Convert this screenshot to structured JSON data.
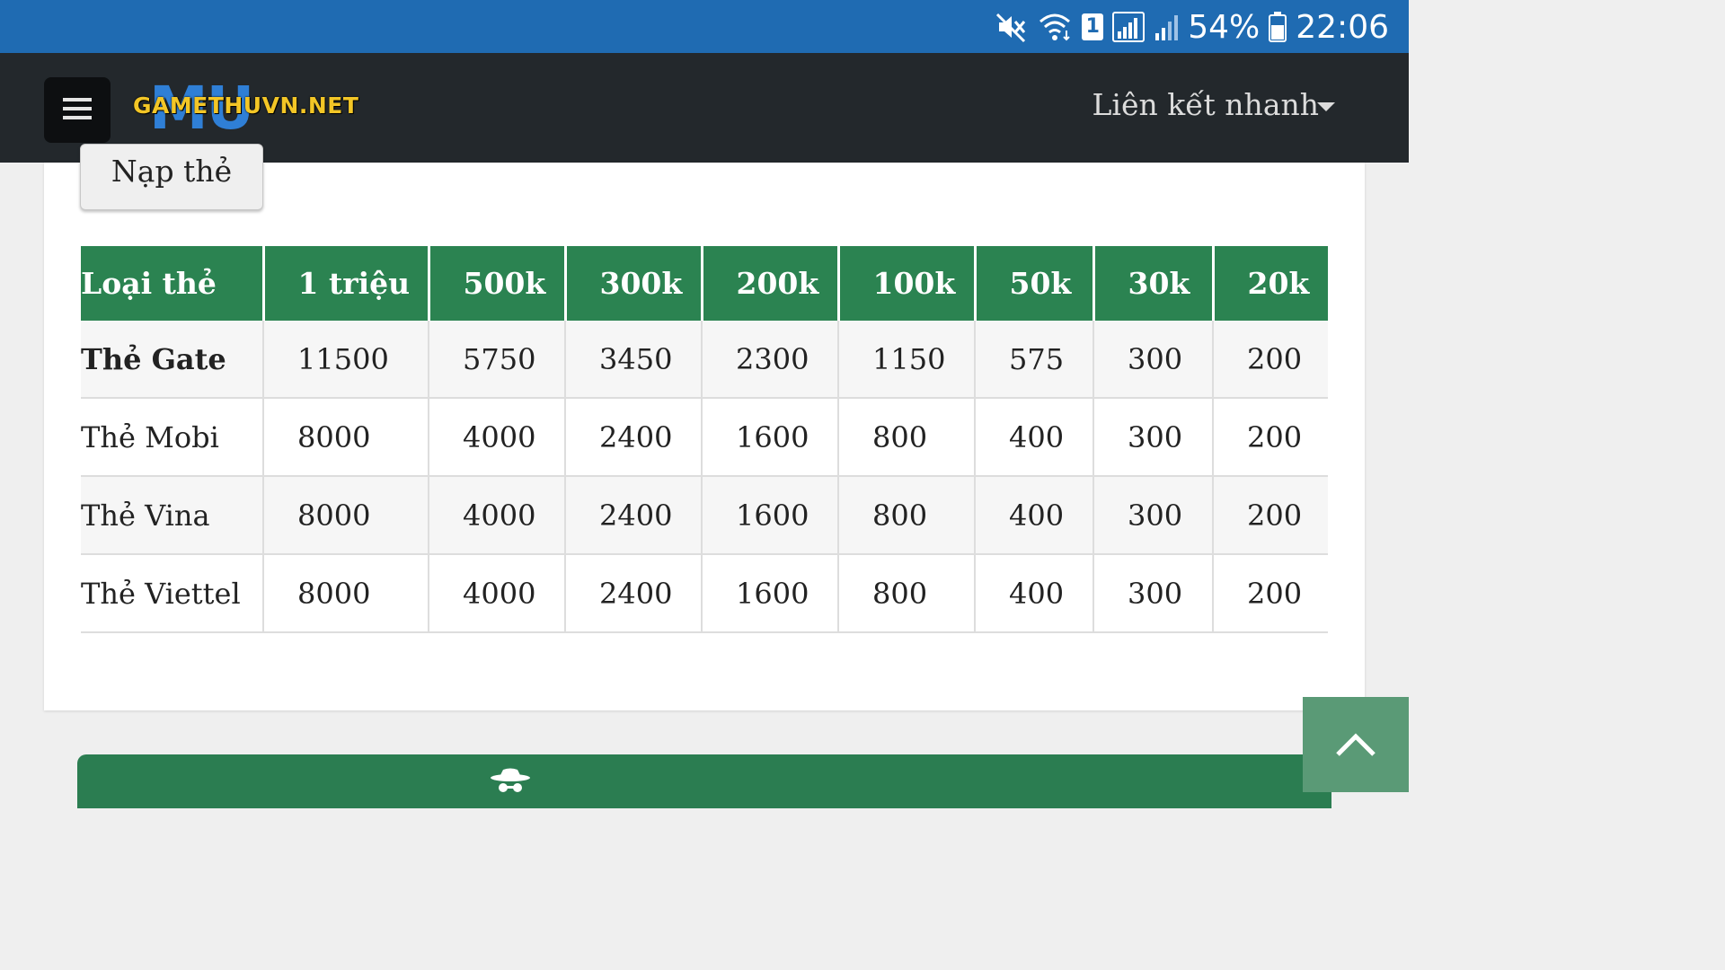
{
  "status_bar": {
    "battery_percent": "54%",
    "time": "22:06",
    "sim_badge": "1",
    "icons": [
      "mute-icon",
      "wifi-icon",
      "sim-icon",
      "signal-icon",
      "signal-2-icon",
      "battery-icon"
    ]
  },
  "navbar": {
    "menu_icon": "hamburger-icon",
    "logo_text": "GAMETHUVN.NET",
    "logo_mark": "MU",
    "quick_links_label": "Liên kết nhanh"
  },
  "content": {
    "recharge_button_label": "Nạp thẻ",
    "table": {
      "headers": [
        "Loại thẻ",
        "1 triệu",
        "500k",
        "300k",
        "200k",
        "100k",
        "50k",
        "30k",
        "20k"
      ],
      "rows": [
        [
          "Thẻ Gate",
          "11500",
          "5750",
          "3450",
          "2300",
          "1150",
          "575",
          "300",
          "200"
        ],
        [
          "Thẻ Mobi",
          "8000",
          "4000",
          "2400",
          "1600",
          "800",
          "400",
          "300",
          "200"
        ],
        [
          "Thẻ Vina",
          "8000",
          "4000",
          "2400",
          "1600",
          "800",
          "400",
          "300",
          "200"
        ],
        [
          "Thẻ Viettel",
          "8000",
          "4000",
          "2400",
          "1600",
          "800",
          "400",
          "300",
          "200"
        ]
      ]
    }
  },
  "colors": {
    "status_bar": "#1f6bb2",
    "navbar": "#23282c",
    "table_header": "#2b8351",
    "footer_bar": "#2b7d51",
    "back_to_top": "#5a9a76",
    "logo_yellow": "#f3c626",
    "logo_blue": "#2f7fd6"
  },
  "footer": {
    "icon": "spy-icon"
  },
  "back_to_top": {
    "icon": "chevron-up-icon"
  }
}
